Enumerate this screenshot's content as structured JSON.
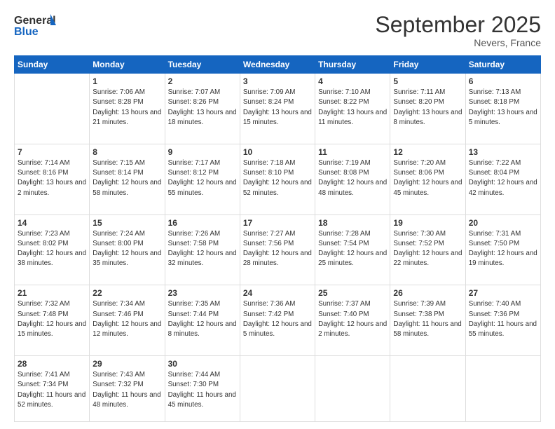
{
  "logo": {
    "line1": "General",
    "line2": "Blue"
  },
  "title": "September 2025",
  "subtitle": "Nevers, France",
  "weekdays": [
    "Sunday",
    "Monday",
    "Tuesday",
    "Wednesday",
    "Thursday",
    "Friday",
    "Saturday"
  ],
  "weeks": [
    [
      {
        "day": "",
        "info": ""
      },
      {
        "day": "1",
        "info": "Sunrise: 7:06 AM\nSunset: 8:28 PM\nDaylight: 13 hours\nand 21 minutes."
      },
      {
        "day": "2",
        "info": "Sunrise: 7:07 AM\nSunset: 8:26 PM\nDaylight: 13 hours\nand 18 minutes."
      },
      {
        "day": "3",
        "info": "Sunrise: 7:09 AM\nSunset: 8:24 PM\nDaylight: 13 hours\nand 15 minutes."
      },
      {
        "day": "4",
        "info": "Sunrise: 7:10 AM\nSunset: 8:22 PM\nDaylight: 13 hours\nand 11 minutes."
      },
      {
        "day": "5",
        "info": "Sunrise: 7:11 AM\nSunset: 8:20 PM\nDaylight: 13 hours\nand 8 minutes."
      },
      {
        "day": "6",
        "info": "Sunrise: 7:13 AM\nSunset: 8:18 PM\nDaylight: 13 hours\nand 5 minutes."
      }
    ],
    [
      {
        "day": "7",
        "info": "Sunrise: 7:14 AM\nSunset: 8:16 PM\nDaylight: 13 hours\nand 2 minutes."
      },
      {
        "day": "8",
        "info": "Sunrise: 7:15 AM\nSunset: 8:14 PM\nDaylight: 12 hours\nand 58 minutes."
      },
      {
        "day": "9",
        "info": "Sunrise: 7:17 AM\nSunset: 8:12 PM\nDaylight: 12 hours\nand 55 minutes."
      },
      {
        "day": "10",
        "info": "Sunrise: 7:18 AM\nSunset: 8:10 PM\nDaylight: 12 hours\nand 52 minutes."
      },
      {
        "day": "11",
        "info": "Sunrise: 7:19 AM\nSunset: 8:08 PM\nDaylight: 12 hours\nand 48 minutes."
      },
      {
        "day": "12",
        "info": "Sunrise: 7:20 AM\nSunset: 8:06 PM\nDaylight: 12 hours\nand 45 minutes."
      },
      {
        "day": "13",
        "info": "Sunrise: 7:22 AM\nSunset: 8:04 PM\nDaylight: 12 hours\nand 42 minutes."
      }
    ],
    [
      {
        "day": "14",
        "info": "Sunrise: 7:23 AM\nSunset: 8:02 PM\nDaylight: 12 hours\nand 38 minutes."
      },
      {
        "day": "15",
        "info": "Sunrise: 7:24 AM\nSunset: 8:00 PM\nDaylight: 12 hours\nand 35 minutes."
      },
      {
        "day": "16",
        "info": "Sunrise: 7:26 AM\nSunset: 7:58 PM\nDaylight: 12 hours\nand 32 minutes."
      },
      {
        "day": "17",
        "info": "Sunrise: 7:27 AM\nSunset: 7:56 PM\nDaylight: 12 hours\nand 28 minutes."
      },
      {
        "day": "18",
        "info": "Sunrise: 7:28 AM\nSunset: 7:54 PM\nDaylight: 12 hours\nand 25 minutes."
      },
      {
        "day": "19",
        "info": "Sunrise: 7:30 AM\nSunset: 7:52 PM\nDaylight: 12 hours\nand 22 minutes."
      },
      {
        "day": "20",
        "info": "Sunrise: 7:31 AM\nSunset: 7:50 PM\nDaylight: 12 hours\nand 19 minutes."
      }
    ],
    [
      {
        "day": "21",
        "info": "Sunrise: 7:32 AM\nSunset: 7:48 PM\nDaylight: 12 hours\nand 15 minutes."
      },
      {
        "day": "22",
        "info": "Sunrise: 7:34 AM\nSunset: 7:46 PM\nDaylight: 12 hours\nand 12 minutes."
      },
      {
        "day": "23",
        "info": "Sunrise: 7:35 AM\nSunset: 7:44 PM\nDaylight: 12 hours\nand 8 minutes."
      },
      {
        "day": "24",
        "info": "Sunrise: 7:36 AM\nSunset: 7:42 PM\nDaylight: 12 hours\nand 5 minutes."
      },
      {
        "day": "25",
        "info": "Sunrise: 7:37 AM\nSunset: 7:40 PM\nDaylight: 12 hours\nand 2 minutes."
      },
      {
        "day": "26",
        "info": "Sunrise: 7:39 AM\nSunset: 7:38 PM\nDaylight: 11 hours\nand 58 minutes."
      },
      {
        "day": "27",
        "info": "Sunrise: 7:40 AM\nSunset: 7:36 PM\nDaylight: 11 hours\nand 55 minutes."
      }
    ],
    [
      {
        "day": "28",
        "info": "Sunrise: 7:41 AM\nSunset: 7:34 PM\nDaylight: 11 hours\nand 52 minutes."
      },
      {
        "day": "29",
        "info": "Sunrise: 7:43 AM\nSunset: 7:32 PM\nDaylight: 11 hours\nand 48 minutes."
      },
      {
        "day": "30",
        "info": "Sunrise: 7:44 AM\nSunset: 7:30 PM\nDaylight: 11 hours\nand 45 minutes."
      },
      {
        "day": "",
        "info": ""
      },
      {
        "day": "",
        "info": ""
      },
      {
        "day": "",
        "info": ""
      },
      {
        "day": "",
        "info": ""
      }
    ]
  ]
}
